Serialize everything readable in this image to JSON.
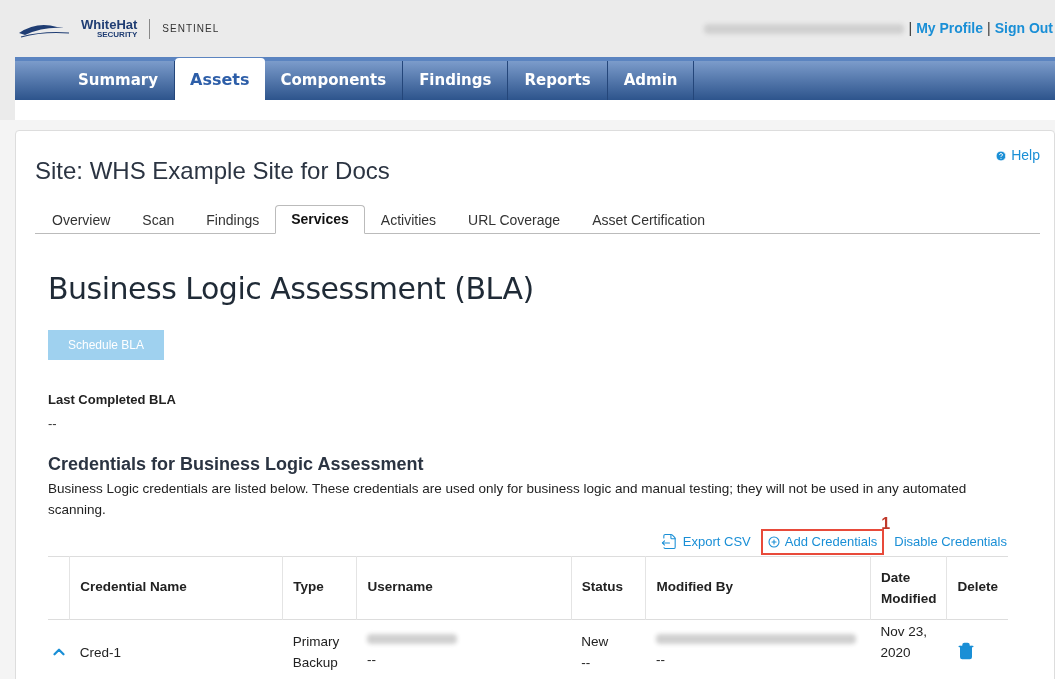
{
  "header": {
    "logo": {
      "name": "WhiteHat",
      "tagline": "SECURITY",
      "product": "SENTINEL"
    },
    "links": [
      "My Profile",
      "Sign Out"
    ],
    "separator": "|"
  },
  "nav": [
    {
      "label": "Summary",
      "selected": false
    },
    {
      "label": "Assets",
      "selected": true
    },
    {
      "label": "Components",
      "selected": false
    },
    {
      "label": "Findings",
      "selected": false
    },
    {
      "label": "Reports",
      "selected": false
    },
    {
      "label": "Admin",
      "selected": false
    }
  ],
  "help": "Help",
  "site_title": "Site: WHS Example Site for Docs",
  "tabs": [
    {
      "label": "Overview",
      "selected": false
    },
    {
      "label": "Scan",
      "selected": false
    },
    {
      "label": "Findings",
      "selected": false
    },
    {
      "label": "Services",
      "selected": true
    },
    {
      "label": "Activities",
      "selected": false
    },
    {
      "label": "URL Coverage",
      "selected": false
    },
    {
      "label": "Asset Certification",
      "selected": false
    }
  ],
  "heading": "Business Logic Assessment (BLA)",
  "schedule_button": {
    "label": "Schedule BLA",
    "disabled": true
  },
  "last_completed": {
    "label": "Last Completed BLA",
    "value": "--"
  },
  "credentials": {
    "title": "Credentials for Business Logic Assessment",
    "description": "Business Logic credentials are listed below. These credentials are used only for business logic and manual testing; they will not be used in any automated scanning.",
    "actions": [
      {
        "label": "Export CSV",
        "kind": "export",
        "highlighted": false
      },
      {
        "label": "Add Credentials",
        "kind": "add",
        "highlighted": true,
        "marker": "1"
      },
      {
        "label": "Disable Credentials",
        "kind": "plain",
        "highlighted": false
      }
    ],
    "columns": [
      "Credential Name",
      "Type",
      "Username",
      "Status",
      "Modified By",
      "Date Modified",
      "Delete"
    ],
    "rows": [
      {
        "expanded": true,
        "name": "Cred-1",
        "type": "Primary Backup",
        "username": "--",
        "status": "New",
        "status_detail": "--",
        "modified_by": "--",
        "date": "Nov 23, 2020"
      }
    ]
  }
}
